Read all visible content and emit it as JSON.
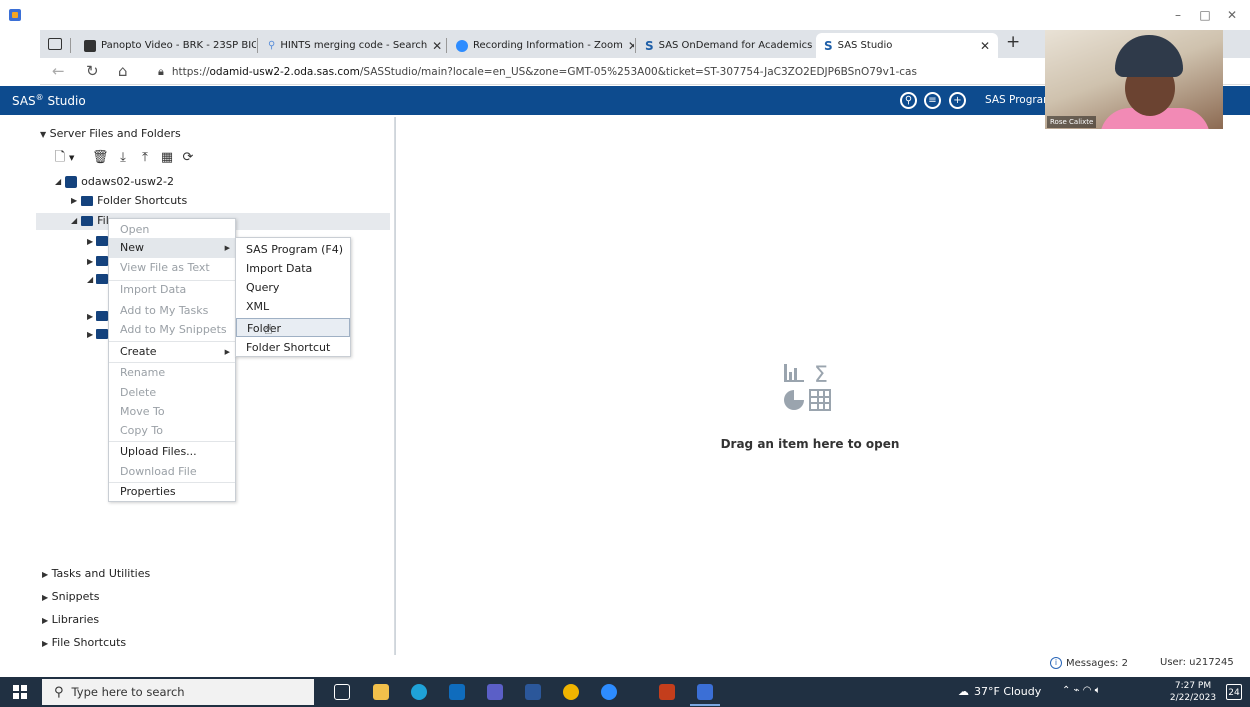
{
  "browser": {
    "tabs": [
      {
        "title": "Panopto Video - BRK - 23SP BIO(",
        "favicon_color": "#333333"
      },
      {
        "title": "HINTS merging code - Search",
        "favicon_color": "#5b8fd9"
      },
      {
        "title": "Recording Information - Zoom",
        "favicon_color": "#2d8cff"
      },
      {
        "title": "SAS OnDemand for Academics",
        "favicon_color": "#1f5fa8"
      },
      {
        "title": "SAS Studio",
        "favicon_color": "#1f5fa8"
      }
    ],
    "url_prefix": "https://",
    "url_host": "odamid-usw2-2.oda.sas.com",
    "url_rest": "/SASStudio/main?locale=en_US&zone=GMT-05%253A00&ticket=ST-307754-JaC3ZO2EDJP6BSnO79v1-cas"
  },
  "sas_header": {
    "title": "SAS",
    "title_sup": "®",
    "title_rest": " Studio",
    "program_tab": "SAS Prograr",
    "brand_color": "#0d4b8e"
  },
  "webcam": {
    "name": "Rose Calixte"
  },
  "left_panel": {
    "section_title": "Server Files and Folders",
    "server": "odaws02-usw2-2",
    "folder_shortcuts": "Folder Shortcuts",
    "files_home": "File",
    "bottom_sections": [
      "Tasks and Utilities",
      "Snippets",
      "Libraries",
      "File Shortcuts"
    ]
  },
  "context_menu": {
    "items": [
      {
        "label": "Open",
        "disabled": true
      },
      {
        "label": "New",
        "disabled": false,
        "submenu": true,
        "highlight": true
      },
      {
        "label": "View File as Text",
        "disabled": true
      },
      {
        "label": "Import Data",
        "disabled": true
      },
      {
        "label": "Add to My Tasks",
        "disabled": true
      },
      {
        "label": "Add to My Snippets",
        "disabled": true
      },
      {
        "label": "Create",
        "disabled": false,
        "submenu": true
      },
      {
        "label": "Rename",
        "disabled": true
      },
      {
        "label": "Delete",
        "disabled": true
      },
      {
        "label": "Move To",
        "disabled": true
      },
      {
        "label": "Copy To",
        "disabled": true
      },
      {
        "label": "Upload Files...",
        "disabled": false
      },
      {
        "label": "Download File",
        "disabled": true
      },
      {
        "label": "Properties",
        "disabled": false
      }
    ]
  },
  "submenu": {
    "items": [
      "SAS Program (F4)",
      "Import Data",
      "Query",
      "XML",
      "Folder",
      "Folder Shortcut"
    ]
  },
  "main": {
    "drop_text": "Drag an item here to open"
  },
  "status": {
    "messages": "Messages: 2",
    "user": "User: u217245"
  },
  "taskbar": {
    "search_placeholder": "Type here to search",
    "weather": "37°F  Cloudy",
    "time": "7:27 PM",
    "date": "2/22/2023",
    "notifications": "24"
  }
}
